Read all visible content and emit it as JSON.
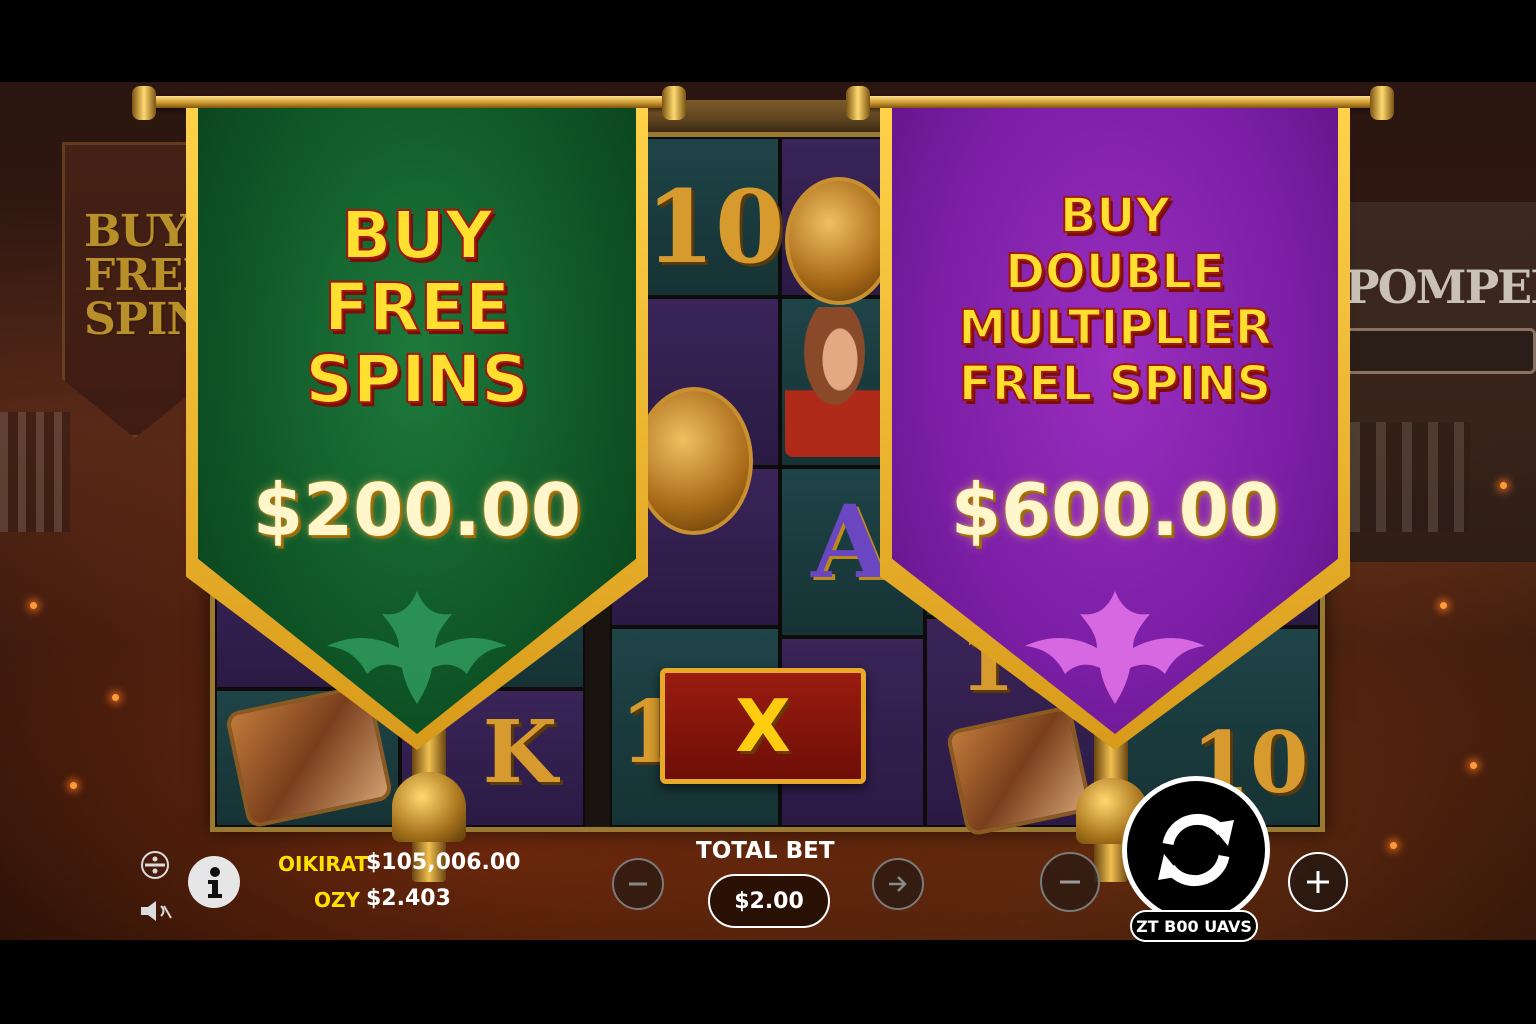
{
  "game": {
    "bg_banner_left_text": "BUY\nFREE\nSPIN",
    "bg_sign_right_text": "POMPEII",
    "colors": {
      "green_banner": "#0f5526",
      "purple_banner": "#7a1ea4",
      "gold_trim": "#ffd24a",
      "title_yellow": "#ffe030",
      "close_red": "#9a1c10"
    }
  },
  "reels": {
    "symbols": [
      "10",
      "coin",
      "portrait",
      "A",
      "K",
      "10",
      "10",
      "10",
      "scroll",
      "scroll",
      "coin"
    ]
  },
  "offers": [
    {
      "title": "BUY\nFREE\nSPINS",
      "price": "$200.00",
      "color": "green"
    },
    {
      "title": "BUY\nDOUBLE\nMULTIPLIER\nFREL SPINS",
      "price": "$600.00",
      "color": "purple"
    }
  ],
  "close_button": {
    "label": "X"
  },
  "hud": {
    "credit_label": "OIKIRAT",
    "credit_value": "$105,006.00",
    "bet_label": "OZY",
    "bet_value": "$2.403",
    "total_bet_label": "TOTAL BET",
    "total_bet_value": "$2.00",
    "turbo_label": "ZT B00 UAVS",
    "icons": [
      "settings-icon",
      "info-icon",
      "sound-icon",
      "minus-icon",
      "arrow-right-icon",
      "spin-icon",
      "plus-icon"
    ]
  }
}
